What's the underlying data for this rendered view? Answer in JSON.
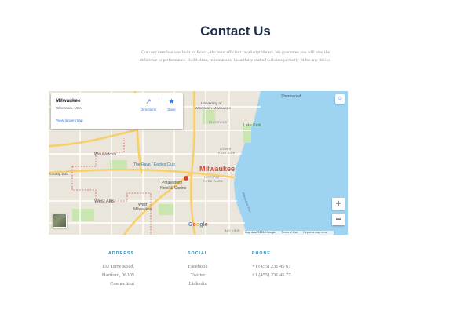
{
  "title": "Contact Us",
  "intro": {
    "line1": "Our user interface was built on React - the most efficient JavaScript library. We guarantee you will love the",
    "line2": "difference in performance. Build clean, minimalistic, beautifully crafted websites perfectly fit for any device."
  },
  "map": {
    "card": {
      "place": "Milwaukee",
      "region": "Wisconsin, USA",
      "directions_label": "Directions",
      "save_label": "Save",
      "larger_map_link": "View larger map"
    },
    "zoom_in": "+",
    "zoom_out": "−",
    "google_letters": [
      "G",
      "o",
      "o",
      "g",
      "l",
      "e"
    ],
    "google_colors": [
      "#4285F4",
      "#EA4335",
      "#FBBC05",
      "#4285F4",
      "#34A853",
      "#EA4335"
    ],
    "attribution": {
      "data": "Map data ©2018 Google",
      "terms": "Terms of Use",
      "report": "Report a map error"
    },
    "labels": {
      "city": "Milwaukee",
      "shorewood": "Shorewood",
      "university": "University of",
      "university2": "Wisconsin-Milwaukee",
      "riverwest": "RIVERWEST",
      "lake_park": "Lake Park",
      "wauwatosa": "Wauwatosa",
      "county_zoo": "County Zoo",
      "rave": "The Rave / Eagles Club",
      "potawatomi": "Potawatomi",
      "potawatomi2": "Hotel & Casino",
      "west_allis": "West Allis",
      "west_milwaukee": "West",
      "west_milwaukee2": "Milwaukee",
      "third_ward": "HISTORIC",
      "third_ward2": "THIRD WARD",
      "lower_east": "LOWER",
      "lower_east2": "EAST SIDE",
      "lake_michigan": "Milwaukee Pier",
      "bay_view": "BAY VIEW"
    },
    "colors": {
      "water": "#9fd3f2",
      "land": "#ebe6db",
      "park": "#c9e5b0",
      "highway": "#f7cf6b",
      "boundary": "#e05a55",
      "city_label": "#d2413a",
      "accent": "#3b78e7"
    }
  },
  "contact": {
    "address": {
      "heading": "ADDRESS",
      "lines": [
        "132 Terry Road,",
        "Hartford, 06105",
        "Connecticut"
      ]
    },
    "social": {
      "heading": "SOCIAL",
      "links": [
        "Facebook",
        "Twitter",
        "Linkedin"
      ]
    },
    "phone": {
      "heading": "PHONE",
      "numbers": [
        "+1 (455) 231 45 67",
        "+1 (455) 231 45 77"
      ]
    },
    "heading_color": "#2a8fb7"
  }
}
